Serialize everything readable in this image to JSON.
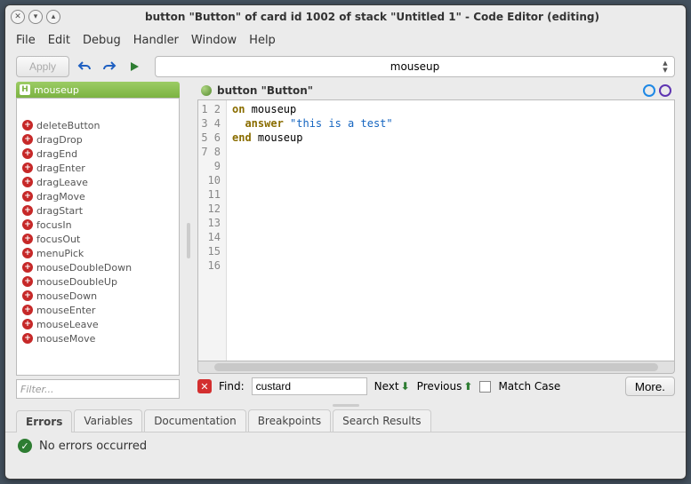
{
  "window": {
    "title": "button \"Button\" of card id 1002 of stack \"Untitled 1\" - Code Editor (editing)"
  },
  "menu": {
    "file": "File",
    "edit": "Edit",
    "debug": "Debug",
    "handler": "Handler",
    "window": "Window",
    "help": "Help"
  },
  "toolbar": {
    "apply": "Apply",
    "handler_selected": "mouseup"
  },
  "sidebar": {
    "current_handler": "mouseup",
    "items": [
      "deleteButton",
      "dragDrop",
      "dragEnd",
      "dragEnter",
      "dragLeave",
      "dragMove",
      "dragStart",
      "focusIn",
      "focusOut",
      "menuPick",
      "mouseDoubleDown",
      "mouseDoubleUp",
      "mouseDown",
      "mouseEnter",
      "mouseLeave",
      "mouseMove"
    ],
    "filter_placeholder": "Filter..."
  },
  "editor": {
    "object_label": "button \"Button\"",
    "line_count": 16,
    "code": {
      "l1a": "on",
      "l1b": " mouseup",
      "l2a": "answer",
      "l2b": " \"this is a test\"",
      "l3a": "end",
      "l3b": " mouseup"
    }
  },
  "find": {
    "label": "Find:",
    "value": "custard",
    "next": "Next",
    "previous": "Previous",
    "match_case": "Match Case",
    "more": "More."
  },
  "tabs": {
    "errors": "Errors",
    "variables": "Variables",
    "documentation": "Documentation",
    "breakpoints": "Breakpoints",
    "search_results": "Search Results"
  },
  "status": {
    "message": "No errors occurred"
  }
}
